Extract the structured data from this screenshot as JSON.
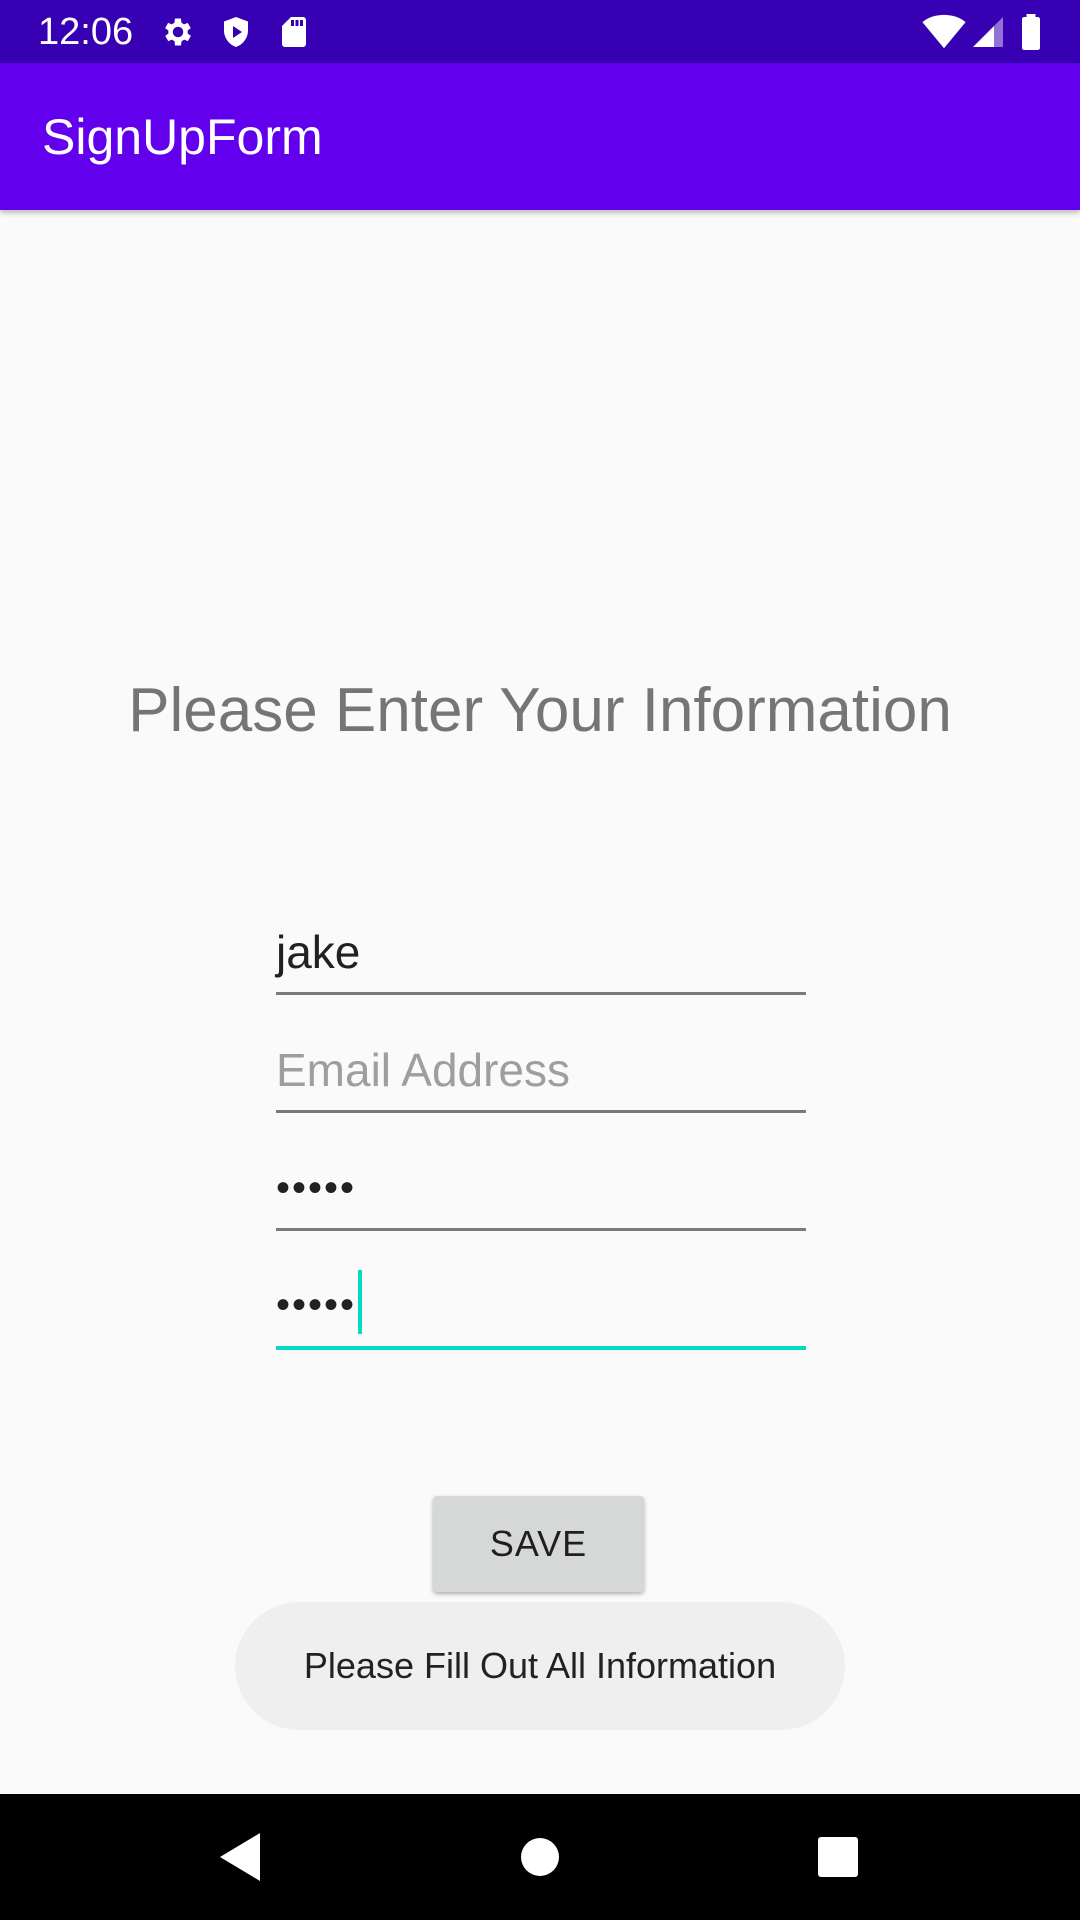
{
  "status_bar": {
    "time": "12:06",
    "left_icons": [
      "gear-icon",
      "shield-icon",
      "sd-card-icon"
    ],
    "right_icons": [
      "wifi-icon",
      "cellular-signal-icon",
      "battery-icon"
    ]
  },
  "app_bar": {
    "title": "SignUpForm"
  },
  "form": {
    "heading": "Please Enter Your Information",
    "name_value": "jake",
    "email_placeholder": "Email Address",
    "email_value": "",
    "password_value": "•••••",
    "confirm_password_value": "•••••",
    "save_label": "SAVE"
  },
  "toast": {
    "message": "Please Fill Out All Information"
  },
  "nav_bar": {
    "icons": [
      "back-icon",
      "home-icon",
      "recents-icon"
    ]
  },
  "colors": {
    "status_bar": "#3700b3",
    "app_bar": "#6200ee",
    "focus_accent": "#03dac5",
    "background": "#fafafa"
  }
}
